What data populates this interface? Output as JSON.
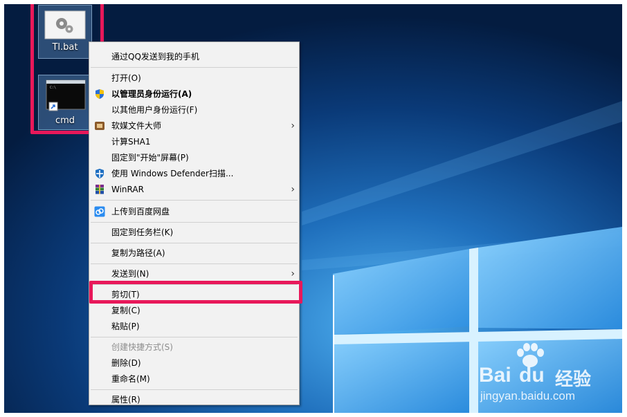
{
  "desktop": {
    "icons": [
      {
        "label": "Tl.bat",
        "icon": "batch-file-gears-icon"
      },
      {
        "label": "cmd",
        "icon": "command-prompt-shortcut-icon"
      }
    ]
  },
  "context_menu": {
    "items": [
      {
        "label": "通过QQ发送到我的手机",
        "icon": ""
      },
      {
        "label": "打开(O)",
        "icon": ""
      },
      {
        "label": "以管理员身份运行(A)",
        "icon": "uac-shield-icon",
        "bold": true
      },
      {
        "label": "以其他用户身份运行(F)",
        "icon": ""
      },
      {
        "label": "软媒文件大师",
        "icon": "ruanmei-icon",
        "submenu": true
      },
      {
        "label": "计算SHA1",
        "icon": ""
      },
      {
        "label": "固定到\"开始\"屏幕(P)",
        "icon": ""
      },
      {
        "label": "使用 Windows Defender扫描...",
        "icon": "windows-defender-icon"
      },
      {
        "label": "WinRAR",
        "icon": "winrar-icon",
        "submenu": true
      },
      {
        "label": "上传到百度网盘",
        "icon": "baidu-netdisk-icon"
      },
      {
        "label": "固定到任务栏(K)",
        "icon": ""
      },
      {
        "label": "复制为路径(A)",
        "icon": ""
      },
      {
        "label": "发送到(N)",
        "icon": "",
        "submenu": true
      },
      {
        "label": "剪切(T)",
        "icon": ""
      },
      {
        "label": "复制(C)",
        "icon": ""
      },
      {
        "label": "粘贴(P)",
        "icon": ""
      },
      {
        "label": "创建快捷方式(S)",
        "icon": "",
        "disabled": true
      },
      {
        "label": "删除(D)",
        "icon": ""
      },
      {
        "label": "重命名(M)",
        "icon": ""
      },
      {
        "label": "属性(R)",
        "icon": ""
      }
    ]
  },
  "watermark": {
    "brand_latin": "Bai",
    "brand_du": "du",
    "brand_cn": "经验",
    "url": "jingyan.baidu.com"
  },
  "colors": {
    "annotation": "#e8185a",
    "menu_bg": "#f2f2f2",
    "desktop_bg": "#06264e"
  }
}
